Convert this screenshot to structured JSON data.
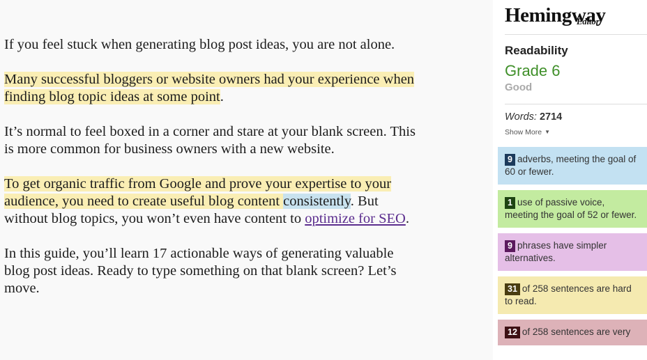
{
  "document": {
    "paragraphs": [
      {
        "id": "p1",
        "segments": [
          {
            "text": "If you feel stuck when generating blog post ideas, you are not alone.",
            "style": "plain"
          }
        ]
      },
      {
        "id": "p2",
        "segments": [
          {
            "text": "Many successful bloggers or website owners had your experience when finding blog topic ideas at some point",
            "style": "highlight-yellow"
          },
          {
            "text": ".",
            "style": "plain"
          }
        ]
      },
      {
        "id": "p3",
        "segments": [
          {
            "text": "It’s normal to feel boxed in a corner and stare at your blank screen. This is more common for business owners with a new website.",
            "style": "plain"
          }
        ]
      },
      {
        "id": "p4",
        "segments": [
          {
            "text": "To get organic traffic from Google and prove your expertise to your audience, you need to create useful blog content ",
            "style": "highlight-yellow"
          },
          {
            "text": "consistently",
            "style": "highlight-blue"
          },
          {
            "text": ". But without blog topics, you won’t even have content to ",
            "style": "plain"
          },
          {
            "text": "optimize for SEO",
            "style": "link"
          },
          {
            "text": ".",
            "style": "plain"
          }
        ]
      },
      {
        "id": "p5",
        "segments": [
          {
            "text": "In this guide, you’ll learn 17 actionable ways of generating valuable blog post ideas. Ready to type something on that blank screen? Let’s move.",
            "style": "plain"
          }
        ]
      }
    ]
  },
  "sidebar": {
    "brand": {
      "main": "Hemingway",
      "sub": "Editor"
    },
    "readability": {
      "title": "Readability",
      "grade": "Grade 6",
      "quality": "Good",
      "grade_color": "#3f8f29"
    },
    "words": {
      "label": "Words:",
      "count": "2714"
    },
    "show_more": {
      "label": "Show More",
      "caret": "▼"
    },
    "cards": [
      {
        "id": "adverbs",
        "badge": "9",
        "text": "adverbs, meeting the goal of 60 or fewer.",
        "bg": "#c3e1f2",
        "badge_bg": "#1b3a5c"
      },
      {
        "id": "passive-voice",
        "badge": "1",
        "text": "use of passive voice, meeting the goal of 52 or fewer.",
        "bg": "#c3eba0",
        "badge_bg": "#1e4412"
      },
      {
        "id": "simpler-alternatives",
        "badge": "9",
        "text": "phrases have simpler alternatives.",
        "bg": "#e5bfe7",
        "badge_bg": "#5c1a5e"
      },
      {
        "id": "hard-to-read",
        "badge": "31",
        "text": "of 258 sentences are hard to read.",
        "bg": "#f5eab0",
        "badge_bg": "#4a3d10"
      },
      {
        "id": "very-hard-to-read",
        "badge": "12",
        "text": "of 258 sentences are very",
        "bg": "#ddb2b8",
        "badge_bg": "#3d1013"
      }
    ]
  }
}
